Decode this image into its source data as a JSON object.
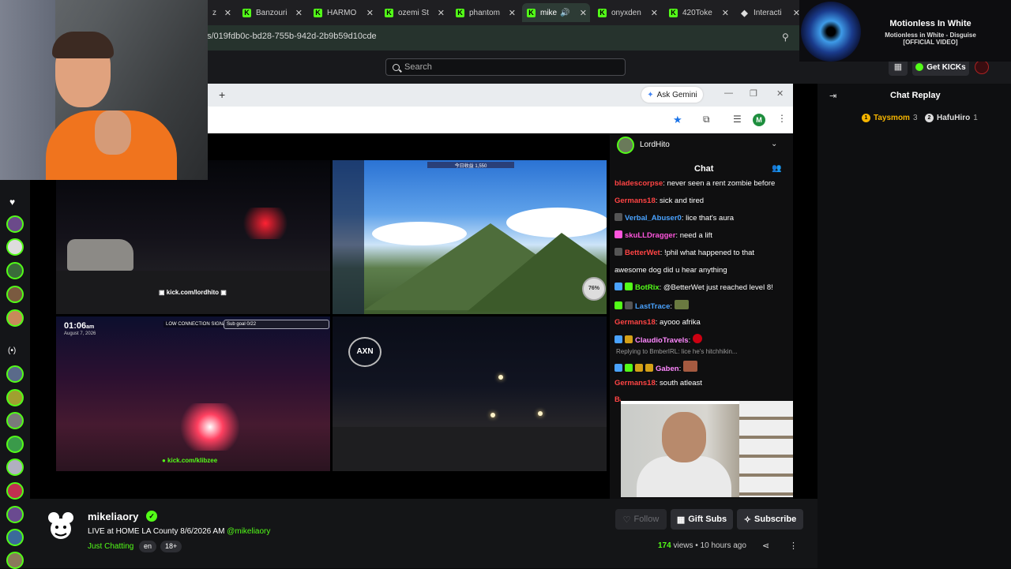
{
  "tabs": [
    {
      "label": "z",
      "favicon": "kick-icon"
    },
    {
      "label": "Banzouri",
      "favicon": "kick-icon"
    },
    {
      "label": "HARMO",
      "favicon": "kick-icon"
    },
    {
      "label": "ozemi St",
      "favicon": "kick-icon"
    },
    {
      "label": "phantom",
      "favicon": "kick-icon"
    },
    {
      "label": "mike",
      "favicon": "kick-icon"
    },
    {
      "label": "onyxden",
      "favicon": "kick-icon"
    },
    {
      "label": "420Toke",
      "favicon": "kick-icon"
    },
    {
      "label": "Interacti",
      "favicon": "diamond-icon"
    }
  ],
  "address": {
    "url": "s/019fdb0c-bd28-755b-942d-2b9b59d10cde"
  },
  "header": {
    "search_placeholder": "Search",
    "get_kicks": "Get KICKs"
  },
  "music": {
    "title": "Motionless In White",
    "subtitle_line1": "Motionless in White - Disguise",
    "subtitle_line2": "[OFFICIAL VIDEO]"
  },
  "inner_browser": {
    "ask_gemini": "Ask Gemini",
    "profile_initial": "M"
  },
  "feeds": {
    "feed1_watermark": "▣ kick.com/lordhito ▣",
    "feed2_hud_top": "今日收益 1,550",
    "feed2_gauge": "76%",
    "feed3_time": "01:06",
    "feed3_ampm": "am",
    "feed3_date": "August 7, 2026",
    "feed3_signal": "LOW CONNECTION SIGNAL",
    "feed3_subgoal": "Sub goal 0/22",
    "feed3_watermark": "● kick.com/klibzee",
    "feed4_logo": "AXN"
  },
  "embedded_chat": {
    "streamer": "LordHito",
    "title": "Chat",
    "messages": [
      {
        "user": "bladescorpse",
        "text": "never seen a rent zombie before",
        "color": "#ff4444"
      },
      {
        "user": "Germans18",
        "text": "sick and tired",
        "color": "#ff4444"
      },
      {
        "user": "Verbal_Abuser0",
        "text": "lice that's aura",
        "color": "#4aa3ff"
      },
      {
        "user": "skuLLDragger",
        "text": "need a lift",
        "color": "#ff55dd"
      },
      {
        "user": "BetterWet",
        "text": "!phil what happened to that",
        "color": "#ff4444"
      },
      {
        "user": "",
        "text": "awesome dog did u hear anything",
        "color": "#ffffff"
      },
      {
        "user": "BotRix",
        "text": "@BetterWet just reached level 8!",
        "color": "#53fc18"
      },
      {
        "user": "LastTrace",
        "text": "",
        "color": "#4aa3ff"
      },
      {
        "user": "Germans18",
        "text": "ayooo afrika",
        "color": "#ff4444"
      },
      {
        "user": "ClaudioTravels",
        "text": "",
        "color": "#ff88ff"
      },
      {
        "user": "Gaben",
        "text": "",
        "color": "#ff88ff"
      },
      {
        "user": "Germans18",
        "text": "south atleast",
        "color": "#ff4444"
      },
      {
        "user": "Badenzer",
        "text": "",
        "color": "#ff4444"
      }
    ],
    "reply_line": "Replying to BmberIRL: lice he's hitchhikin..."
  },
  "replay": {
    "title": "Chat Replay",
    "gifters": [
      {
        "name": "Taysmom",
        "count": "3",
        "rank_color": "#f4b400",
        "rank": "1"
      },
      {
        "name": "HafuHiro",
        "count": "1",
        "rank_color": "#dddddd",
        "rank": "2"
      }
    ]
  },
  "channel": {
    "name": "mikeliaory",
    "title_prefix": "LIVE at HOME LA County 8/6/2026 AM",
    "title_mention": "@mikeliaory",
    "category": "Just Chatting",
    "tags": [
      "en",
      "18+"
    ],
    "follow": "Follow",
    "gift_subs": "Gift Subs",
    "subscribe": "Subscribe",
    "views_count": "174",
    "views_label": "views",
    "age": "10 hours ago"
  }
}
